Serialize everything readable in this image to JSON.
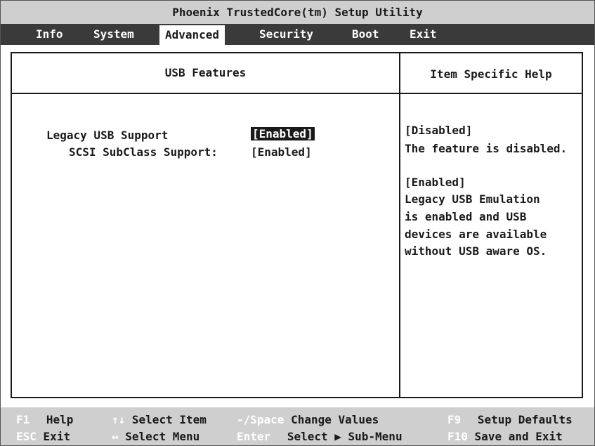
{
  "window": {
    "title": "Phoenix TrustedCore(tm) Setup Utility"
  },
  "menu": {
    "items": [
      {
        "label": "Info"
      },
      {
        "label": "System"
      },
      {
        "label": "Advanced"
      },
      {
        "label": "Security"
      },
      {
        "label": "Boot"
      },
      {
        "label": "Exit"
      }
    ],
    "active": "Advanced"
  },
  "main": {
    "section_title": "USB Features",
    "settings": [
      {
        "label": "Legacy USB Support",
        "value": "[Enabled]",
        "selected": true
      },
      {
        "label": "SCSI SubClass Support:",
        "value": "[Enabled]",
        "selected": false
      }
    ]
  },
  "help": {
    "title": "Item Specific Help",
    "lines": [
      "[Disabled]",
      "The feature is disabled.",
      "",
      "[Enabled]",
      "Legacy USB Emulation",
      "is enabled and USB",
      "devices are available",
      "without USB aware OS."
    ]
  },
  "footer": {
    "row1": [
      {
        "key": "F1",
        "desc": "Help"
      },
      {
        "key": "↑↓",
        "desc": "Select Item"
      },
      {
        "key": "-/Space",
        "desc": "Change Values"
      },
      {
        "key": "F9",
        "desc": "Setup Defaults"
      }
    ],
    "row2": [
      {
        "key": "ESC",
        "desc": "Exit"
      },
      {
        "key": "↔",
        "desc": "Select Menu"
      },
      {
        "key": "Enter",
        "desc": "Select ▶ Sub-Menu"
      },
      {
        "key": "F10",
        "desc": "Save and Exit"
      }
    ]
  },
  "colors": {
    "title_bar": "#cfcfcf",
    "menu_bar": "#3a3a3a",
    "footer": "#cfcfcf",
    "highlight_bg": "#1a1a1a",
    "key_text": "#ffffff"
  }
}
